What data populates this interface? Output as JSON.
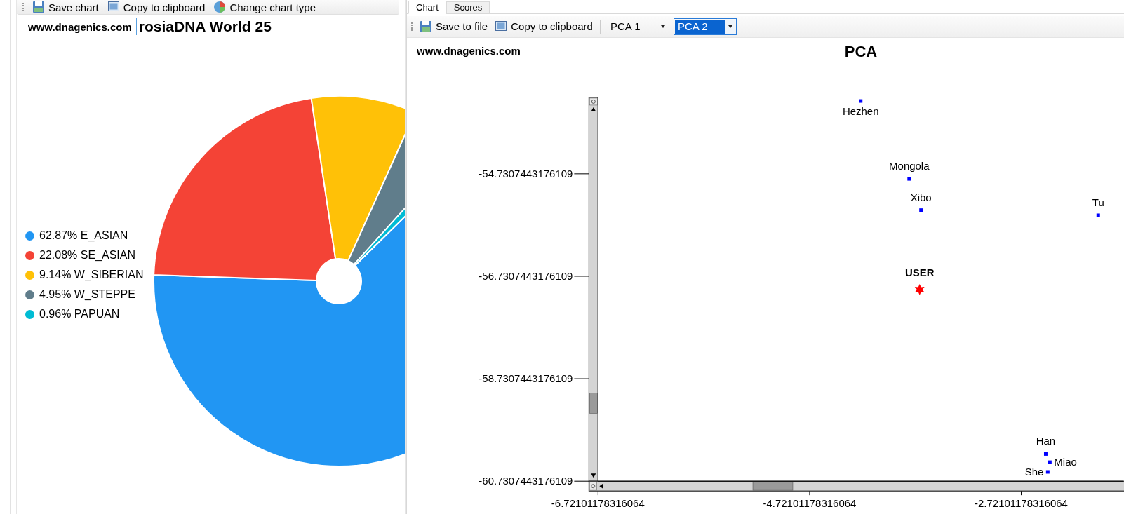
{
  "left_panel": {
    "toolbar": [
      {
        "label": "Save chart",
        "kind": "save"
      },
      {
        "label": "Copy to clipboard",
        "kind": "copy"
      },
      {
        "label": "Change chart type",
        "kind": "chart_type"
      }
    ],
    "watermark_site": "www.dnagenics.com",
    "title": "rosiaDNA World 25",
    "legend": [
      {
        "label": "62.87% E_ASIAN",
        "color": "#2196f3"
      },
      {
        "label": "22.08% SE_ASIAN",
        "color": "#f44336"
      },
      {
        "label": "9.14% W_SIBERIAN",
        "color": "#ffc107"
      },
      {
        "label": "4.95% W_STEPPE",
        "color": "#607d8b"
      },
      {
        "label": "0.96% PAPUAN",
        "color": "#00bcd4"
      }
    ],
    "chart_data": {
      "type": "pie",
      "values": [
        62.87,
        22.08,
        9.14,
        4.95,
        0.96
      ]
    }
  },
  "right_panel": {
    "tabs": [
      {
        "label": "Chart",
        "selected": true
      },
      {
        "label": "Scores",
        "selected": false
      }
    ],
    "toolbar": [
      {
        "label": "Save to file",
        "kind": "save"
      },
      {
        "label": "Copy to clipboard",
        "kind": "copy"
      }
    ],
    "selectors": [
      {
        "value": "PCA 1",
        "focused": false
      },
      {
        "value": "PCA 2",
        "focused": true
      }
    ],
    "watermark_site": "www.dnagenics.com",
    "chart_data": {
      "type": "scatter",
      "title": "PCA",
      "xlim": [
        -6.72101178316064,
        -1.754
      ],
      "ylim": [
        -60.7307443176109,
        -53.24
      ],
      "xticks": [
        {
          "value": -6.72101178316064,
          "label": "-6.72101178316064"
        },
        {
          "value": -4.72101178316064,
          "label": "-4.72101178316064"
        },
        {
          "value": -2.72101178316064,
          "label": "-2.72101178316064"
        }
      ],
      "yticks": [
        {
          "value": -54.7307443176109,
          "label": "-54.7307443176109"
        },
        {
          "value": -56.7307443176109,
          "label": "-56.7307443176109"
        },
        {
          "value": -58.7307443176109,
          "label": "-58.7307443176109"
        },
        {
          "value": -60.7307443176109,
          "label": "-60.7307443176109"
        }
      ],
      "x": [
        -4.238,
        -3.78,
        -3.668,
        -1.993,
        -3.681,
        -2.489,
        -2.45,
        -2.47
      ],
      "series": [
        {
          "color": "#0000ff",
          "values": [
            -53.31,
            -54.83,
            -55.44,
            -55.54,
            null,
            -60.2,
            -60.36,
            -60.55
          ]
        },
        {
          "name": "USER",
          "color": "#ff0000",
          "values": [
            null,
            null,
            null,
            null,
            -56.99,
            null,
            null,
            null
          ]
        }
      ],
      "annotations": [
        {
          "x": -4.238,
          "y": -53.31,
          "text": "Hezhen"
        },
        {
          "x": -3.78,
          "y": -54.83,
          "text": "Mongola"
        },
        {
          "x": -3.668,
          "y": -55.44,
          "text": "Xibo"
        },
        {
          "x": -1.993,
          "y": -55.54,
          "text": "Tu"
        },
        {
          "x": -2.489,
          "y": -60.2,
          "text": "Han"
        },
        {
          "x": -2.45,
          "y": -60.36,
          "text": "Miao"
        },
        {
          "x": -2.47,
          "y": -60.55,
          "text": "She"
        }
      ]
    }
  }
}
